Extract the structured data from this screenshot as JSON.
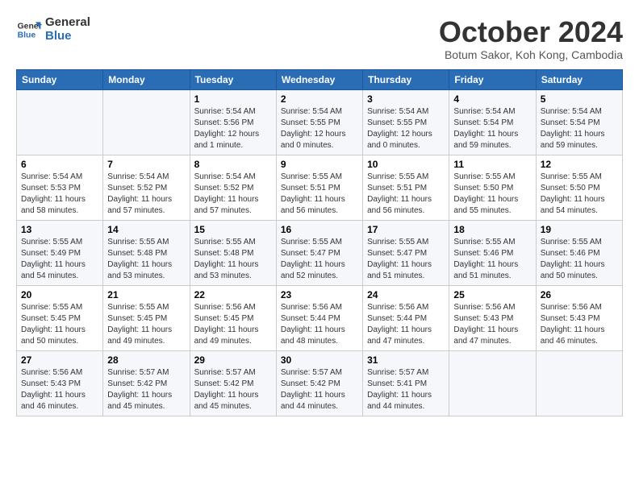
{
  "logo": {
    "line1": "General",
    "line2": "Blue"
  },
  "title": "October 2024",
  "subtitle": "Botum Sakor, Koh Kong, Cambodia",
  "headers": [
    "Sunday",
    "Monday",
    "Tuesday",
    "Wednesday",
    "Thursday",
    "Friday",
    "Saturday"
  ],
  "rows": [
    [
      {
        "day": "",
        "info": ""
      },
      {
        "day": "",
        "info": ""
      },
      {
        "day": "1",
        "info": "Sunrise: 5:54 AM\nSunset: 5:56 PM\nDaylight: 12 hours\nand 1 minute."
      },
      {
        "day": "2",
        "info": "Sunrise: 5:54 AM\nSunset: 5:55 PM\nDaylight: 12 hours\nand 0 minutes."
      },
      {
        "day": "3",
        "info": "Sunrise: 5:54 AM\nSunset: 5:55 PM\nDaylight: 12 hours\nand 0 minutes."
      },
      {
        "day": "4",
        "info": "Sunrise: 5:54 AM\nSunset: 5:54 PM\nDaylight: 11 hours\nand 59 minutes."
      },
      {
        "day": "5",
        "info": "Sunrise: 5:54 AM\nSunset: 5:54 PM\nDaylight: 11 hours\nand 59 minutes."
      }
    ],
    [
      {
        "day": "6",
        "info": "Sunrise: 5:54 AM\nSunset: 5:53 PM\nDaylight: 11 hours\nand 58 minutes."
      },
      {
        "day": "7",
        "info": "Sunrise: 5:54 AM\nSunset: 5:52 PM\nDaylight: 11 hours\nand 57 minutes."
      },
      {
        "day": "8",
        "info": "Sunrise: 5:54 AM\nSunset: 5:52 PM\nDaylight: 11 hours\nand 57 minutes."
      },
      {
        "day": "9",
        "info": "Sunrise: 5:55 AM\nSunset: 5:51 PM\nDaylight: 11 hours\nand 56 minutes."
      },
      {
        "day": "10",
        "info": "Sunrise: 5:55 AM\nSunset: 5:51 PM\nDaylight: 11 hours\nand 56 minutes."
      },
      {
        "day": "11",
        "info": "Sunrise: 5:55 AM\nSunset: 5:50 PM\nDaylight: 11 hours\nand 55 minutes."
      },
      {
        "day": "12",
        "info": "Sunrise: 5:55 AM\nSunset: 5:50 PM\nDaylight: 11 hours\nand 54 minutes."
      }
    ],
    [
      {
        "day": "13",
        "info": "Sunrise: 5:55 AM\nSunset: 5:49 PM\nDaylight: 11 hours\nand 54 minutes."
      },
      {
        "day": "14",
        "info": "Sunrise: 5:55 AM\nSunset: 5:48 PM\nDaylight: 11 hours\nand 53 minutes."
      },
      {
        "day": "15",
        "info": "Sunrise: 5:55 AM\nSunset: 5:48 PM\nDaylight: 11 hours\nand 53 minutes."
      },
      {
        "day": "16",
        "info": "Sunrise: 5:55 AM\nSunset: 5:47 PM\nDaylight: 11 hours\nand 52 minutes."
      },
      {
        "day": "17",
        "info": "Sunrise: 5:55 AM\nSunset: 5:47 PM\nDaylight: 11 hours\nand 51 minutes."
      },
      {
        "day": "18",
        "info": "Sunrise: 5:55 AM\nSunset: 5:46 PM\nDaylight: 11 hours\nand 51 minutes."
      },
      {
        "day": "19",
        "info": "Sunrise: 5:55 AM\nSunset: 5:46 PM\nDaylight: 11 hours\nand 50 minutes."
      }
    ],
    [
      {
        "day": "20",
        "info": "Sunrise: 5:55 AM\nSunset: 5:45 PM\nDaylight: 11 hours\nand 50 minutes."
      },
      {
        "day": "21",
        "info": "Sunrise: 5:55 AM\nSunset: 5:45 PM\nDaylight: 11 hours\nand 49 minutes."
      },
      {
        "day": "22",
        "info": "Sunrise: 5:56 AM\nSunset: 5:45 PM\nDaylight: 11 hours\nand 49 minutes."
      },
      {
        "day": "23",
        "info": "Sunrise: 5:56 AM\nSunset: 5:44 PM\nDaylight: 11 hours\nand 48 minutes."
      },
      {
        "day": "24",
        "info": "Sunrise: 5:56 AM\nSunset: 5:44 PM\nDaylight: 11 hours\nand 47 minutes."
      },
      {
        "day": "25",
        "info": "Sunrise: 5:56 AM\nSunset: 5:43 PM\nDaylight: 11 hours\nand 47 minutes."
      },
      {
        "day": "26",
        "info": "Sunrise: 5:56 AM\nSunset: 5:43 PM\nDaylight: 11 hours\nand 46 minutes."
      }
    ],
    [
      {
        "day": "27",
        "info": "Sunrise: 5:56 AM\nSunset: 5:43 PM\nDaylight: 11 hours\nand 46 minutes."
      },
      {
        "day": "28",
        "info": "Sunrise: 5:57 AM\nSunset: 5:42 PM\nDaylight: 11 hours\nand 45 minutes."
      },
      {
        "day": "29",
        "info": "Sunrise: 5:57 AM\nSunset: 5:42 PM\nDaylight: 11 hours\nand 45 minutes."
      },
      {
        "day": "30",
        "info": "Sunrise: 5:57 AM\nSunset: 5:42 PM\nDaylight: 11 hours\nand 44 minutes."
      },
      {
        "day": "31",
        "info": "Sunrise: 5:57 AM\nSunset: 5:41 PM\nDaylight: 11 hours\nand 44 minutes."
      },
      {
        "day": "",
        "info": ""
      },
      {
        "day": "",
        "info": ""
      }
    ]
  ]
}
